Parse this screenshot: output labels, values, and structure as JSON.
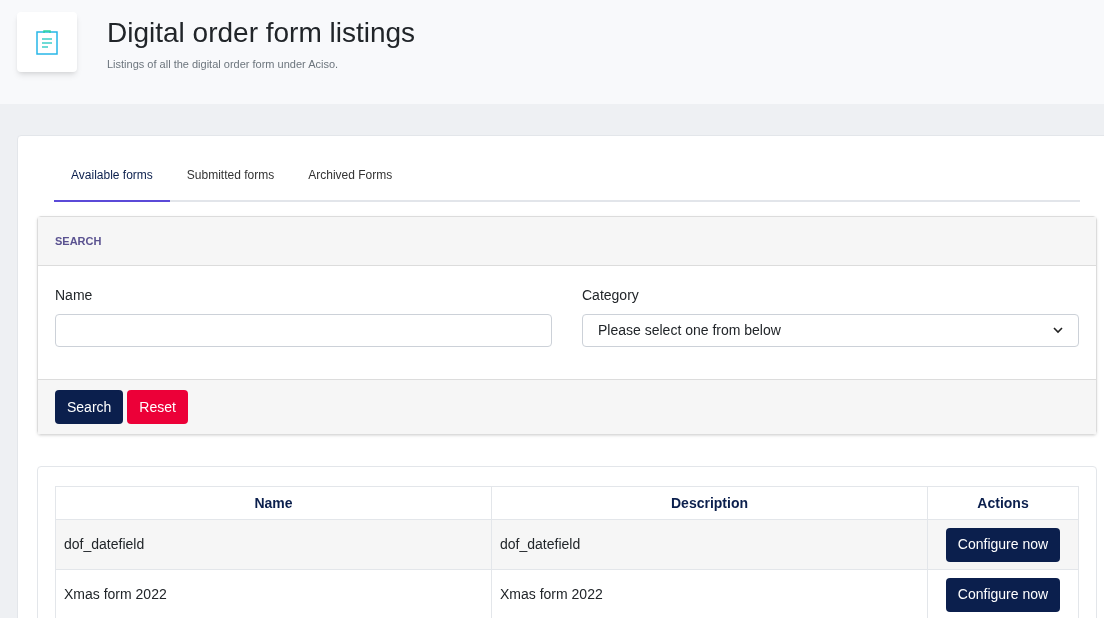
{
  "header": {
    "title": "Digital order form listings",
    "subtitle": "Listings of all the digital order form under Aciso."
  },
  "tabs": [
    {
      "label": "Available forms",
      "selected": true
    },
    {
      "label": "Submitted forms",
      "selected": false
    },
    {
      "label": "Archived Forms",
      "selected": false
    }
  ],
  "search_panel": {
    "heading": "SEARCH",
    "name_label": "Name",
    "category_label": "Category",
    "category_value": "Please select one from below",
    "buttons": [
      {
        "label": "Search",
        "kind": "primary"
      },
      {
        "label": "Reset",
        "kind": "danger"
      }
    ]
  },
  "table": {
    "columns": [
      "Name",
      "Description",
      "Actions"
    ],
    "rows": [
      {
        "name": "dof_datefield",
        "description": "dof_datefield",
        "action": "Configure now"
      },
      {
        "name": "Xmas form 2022",
        "description": "Xmas form 2022",
        "action": "Configure now"
      }
    ]
  }
}
